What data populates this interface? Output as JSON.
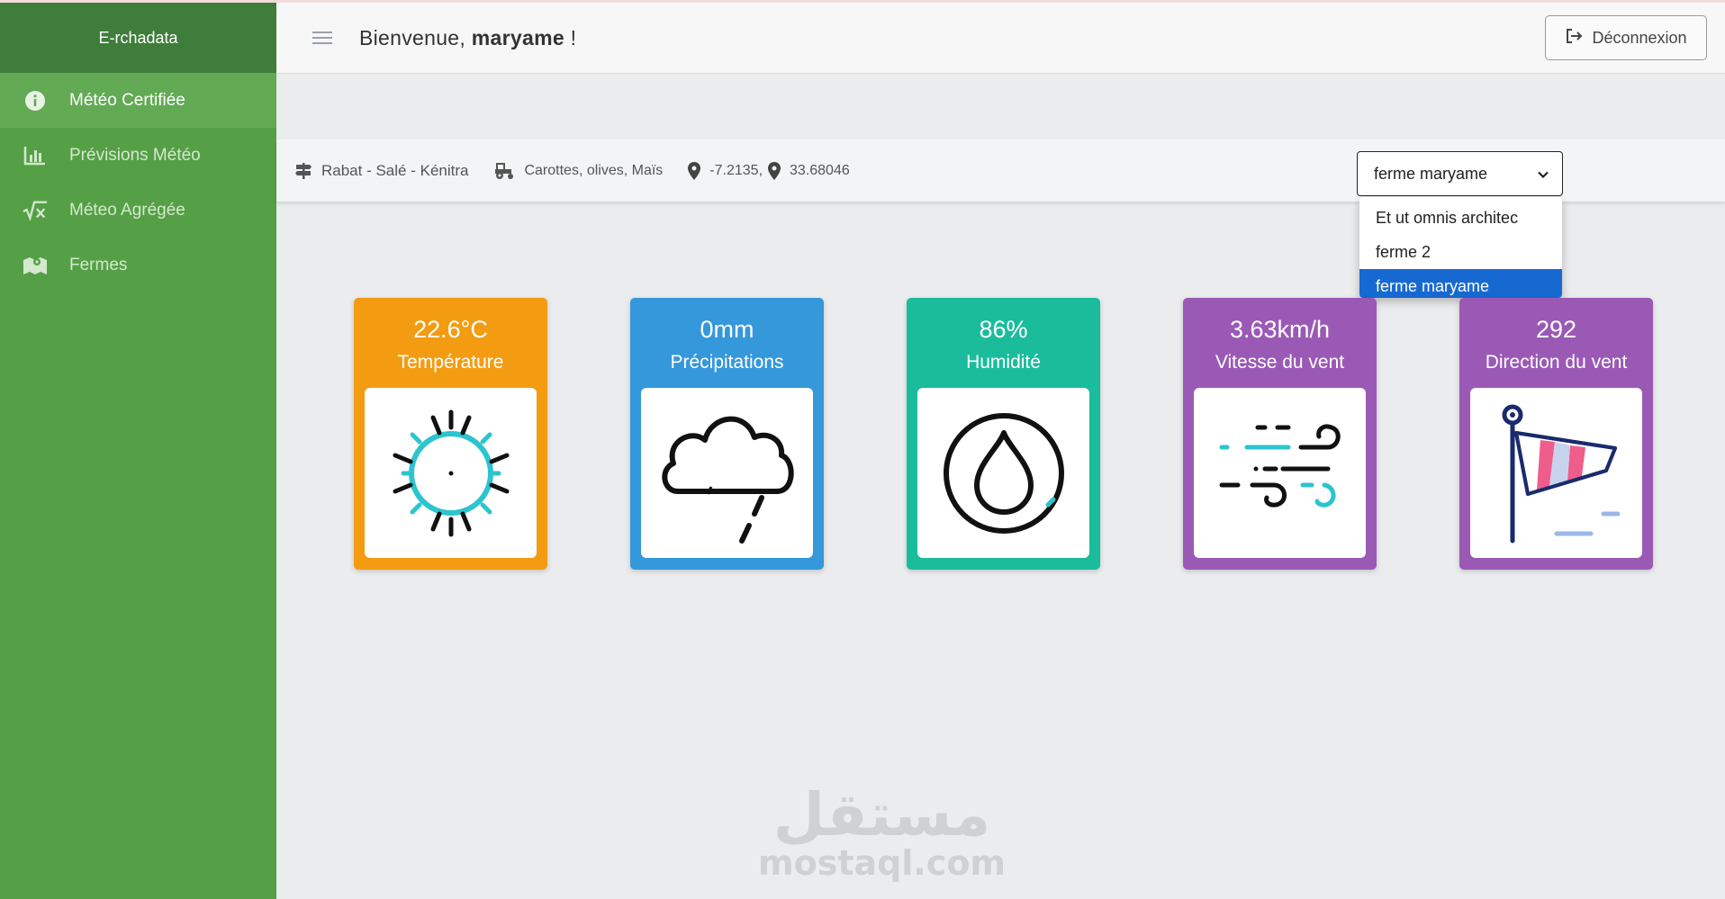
{
  "brand": "E-rchadata",
  "sidebar": {
    "items": [
      {
        "label": "Météo Certifiée",
        "icon": "info-circle-icon",
        "active": true
      },
      {
        "label": "Prévisions Météo",
        "icon": "bar-chart-icon",
        "active": false
      },
      {
        "label": "Méteo Agrégée",
        "icon": "square-root-icon",
        "active": false
      },
      {
        "label": "Fermes",
        "icon": "map-icon",
        "active": false
      }
    ]
  },
  "header": {
    "greeting": "Bienvenue,",
    "username": "maryame",
    "exclaim": "!",
    "logout_label": "Déconnexion"
  },
  "infobar": {
    "region": "Rabat - Salé - Kénitra",
    "crops": "Carottes, olives, Maïs",
    "longitude": "-7.2135,",
    "latitude": "33.68046"
  },
  "farm_select": {
    "value": "ferme maryame",
    "options": [
      "Et ut omnis architec",
      "ferme 2",
      "ferme maryame"
    ],
    "selected_index": 2
  },
  "cards": [
    {
      "value": "22.6°C",
      "label": "Température",
      "color": "#f39c12",
      "icon": "sun-icon"
    },
    {
      "value": "0mm",
      "label": "Précipitations",
      "color": "#3498db",
      "icon": "rain-cloud-icon"
    },
    {
      "value": "86%",
      "label": "Humidité",
      "color": "#1abc9c",
      "icon": "water-drop-icon"
    },
    {
      "value": "3.63km/h",
      "label": "Vitesse du vent",
      "color": "#9b59b6",
      "icon": "wind-icon"
    },
    {
      "value": "292",
      "label": "Direction du vent",
      "color": "#9b59b6",
      "icon": "windsock-icon"
    }
  ],
  "watermark": {
    "arabic": "مستقل",
    "latin": "mostaql.com"
  }
}
